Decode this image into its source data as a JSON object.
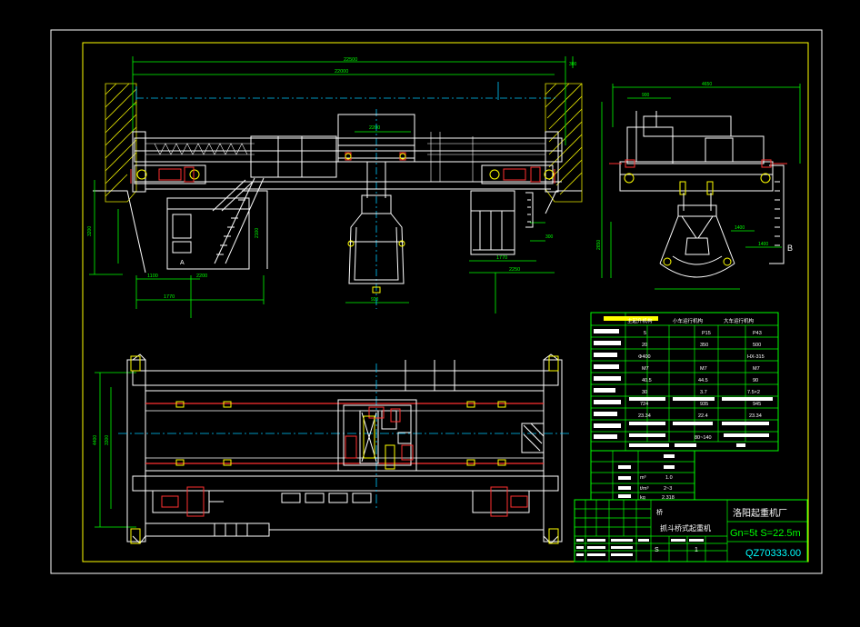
{
  "colors": {
    "background": "#000000",
    "frame": "#ffffff",
    "outline": "#ffff00",
    "structure": "#ffffff",
    "dims": "#00ff00",
    "rails": "#ff3030",
    "center_lines": "#00c8ff",
    "hatch": "#ffff00",
    "title_block": "#00ff00",
    "drawing_no": "#00ffff",
    "accent_green": "#00ff00"
  },
  "title_block": {
    "company": "洛阳起重机厂",
    "spec": "Gn=5t S=22.5m",
    "drawing_number": "QZ70333.00",
    "product_name": "抓斗桥式起重机",
    "sheet_marks": [
      "S",
      "1"
    ]
  },
  "left_view": {
    "dims": [
      "2200",
      "2250",
      "1100",
      "2200",
      "1770",
      "2250"
    ]
  },
  "right_view": {
    "label_b": "B",
    "dims": [
      "1400",
      "1400"
    ]
  },
  "top_view": {
    "dims": [
      "4400",
      "3300"
    ]
  },
  "spec_table": {
    "columns": [
      "主起升机构",
      "小车运行机构",
      "大车运行机构"
    ],
    "rows": [
      [
        "5",
        "P15",
        "P43"
      ],
      [
        "20",
        "350",
        "500"
      ],
      [
        "Φ400",
        "",
        "HX-315"
      ],
      [
        "M7",
        "M7",
        "M7"
      ],
      [
        "40.5",
        "44.5",
        "90"
      ],
      [
        "30",
        "3.7",
        "7.5×2"
      ],
      [
        "724",
        "935",
        "945"
      ],
      [
        "23.34",
        "22.4",
        "23.34"
      ],
      [
        "",
        "80~140",
        ""
      ]
    ]
  },
  "grab_table": {
    "rows": [
      [
        "1.0"
      ],
      [
        "2~3"
      ],
      [
        "2.318"
      ]
    ],
    "units": [
      "m³",
      "t/m³",
      "kg"
    ]
  }
}
